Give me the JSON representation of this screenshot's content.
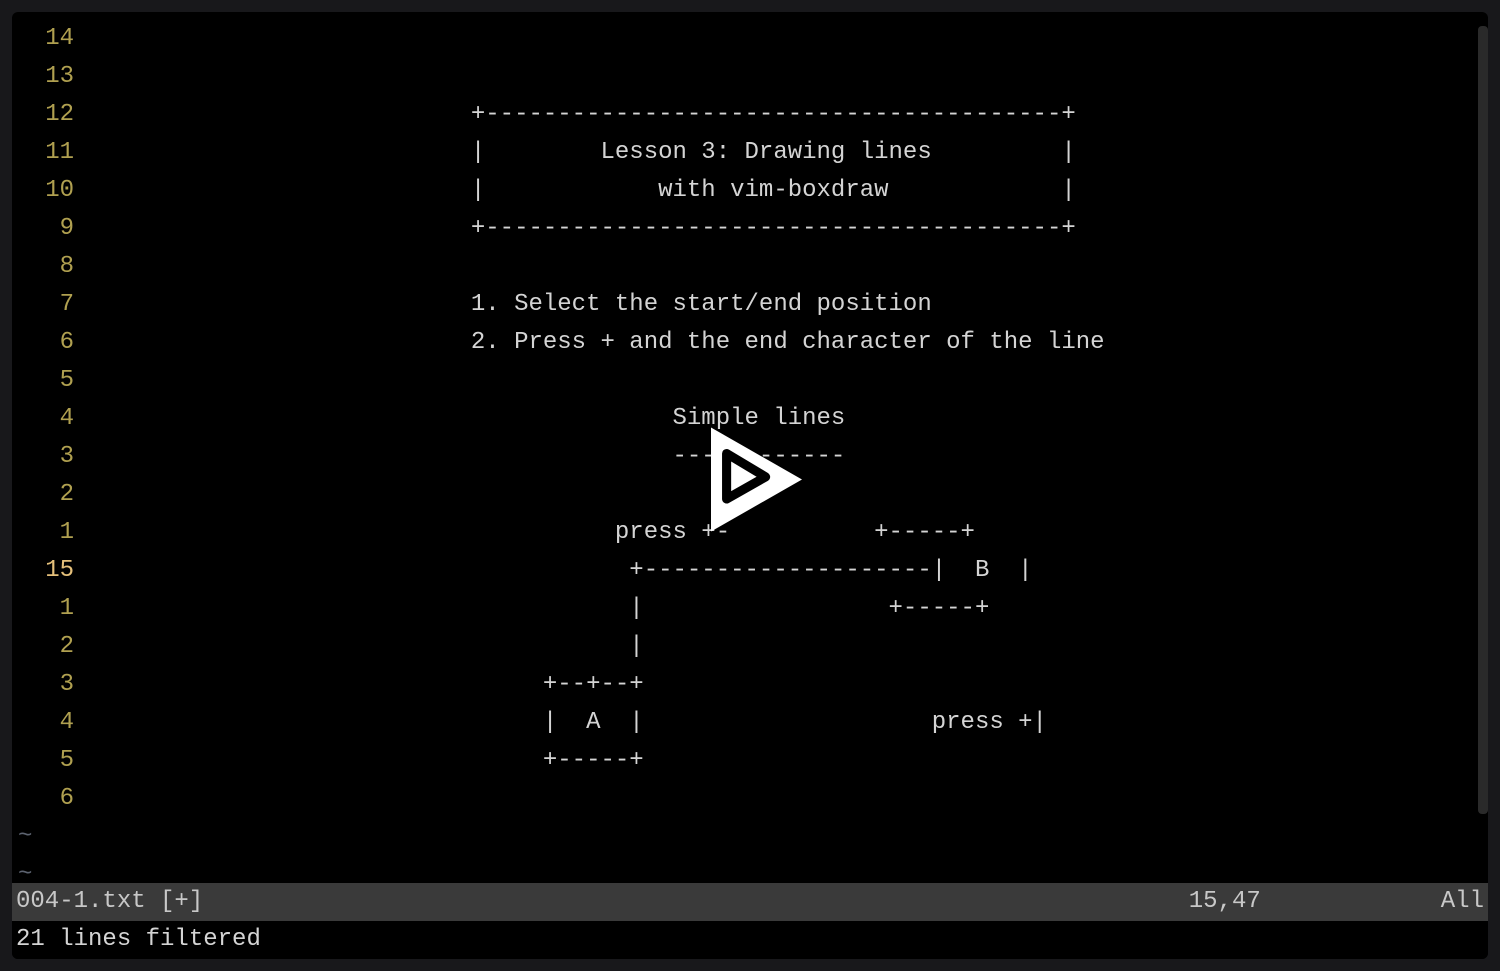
{
  "gutter": {
    "lines": [
      "14",
      "13",
      "12",
      "11",
      "10",
      "9",
      "8",
      "7",
      "6",
      "5",
      "4",
      "3",
      "2",
      "1",
      "15",
      "1",
      "2",
      "3",
      "4",
      "5",
      "6"
    ],
    "currentIndex": 14
  },
  "content": {
    "lines": [
      "",
      "",
      "                           +----------------------------------------+",
      "                           |        Lesson 3: Drawing lines         |",
      "                           |            with vim-boxdraw            |",
      "                           +----------------------------------------+",
      "",
      "                           1. Select the start/end position",
      "                           2. Press + and the end character of the line",
      "",
      "                                         Simple lines",
      "                                         ------------",
      "",
      "                                     press +-          +-----+",
      "                                      +--------------------|  B  |",
      "                                      |                 +-----+",
      "                                      |",
      "                                +--+--+",
      "                                |  A  |                    press +|",
      "                                +-----+",
      ""
    ]
  },
  "tildes": [
    "~",
    "~"
  ],
  "statusBar": {
    "filename": "004-1.txt [+]",
    "position": "15,47",
    "scroll": "All"
  },
  "messageBar": {
    "text": "21 lines filtered"
  }
}
